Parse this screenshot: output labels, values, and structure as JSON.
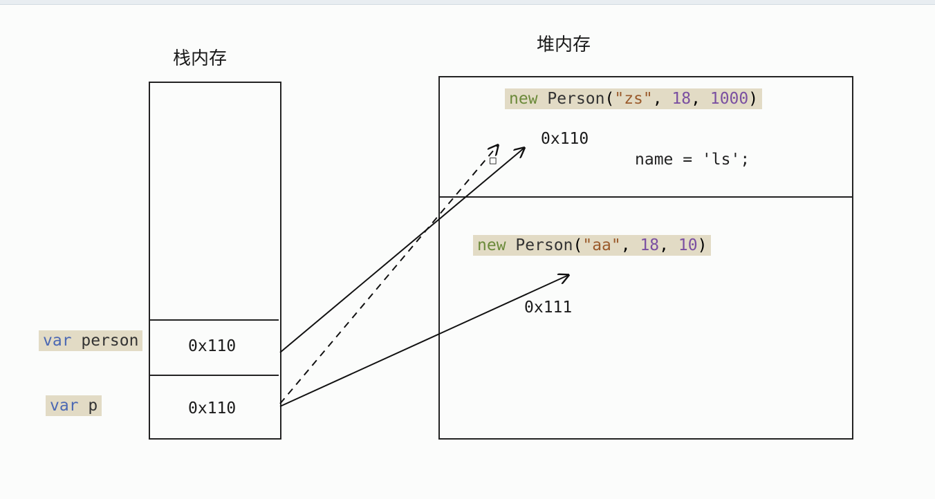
{
  "titles": {
    "stack": "栈内存",
    "heap": "堆内存"
  },
  "stack": {
    "varPerson": "var person",
    "varP": "var p",
    "slot1": "0x110",
    "slot2": "0x110"
  },
  "heap": {
    "obj1": {
      "code": {
        "kwNew": "new",
        "sp1": " ",
        "cls": "Person",
        "open": "(",
        "arg1": "\"zs\"",
        "c1": ", ",
        "arg2": "18",
        "c2": ", ",
        "arg3": "1000",
        "close": ")"
      },
      "addr": "0x110",
      "mutation": "name = 'ls';"
    },
    "obj2": {
      "code": {
        "kwNew": "new",
        "sp1": " ",
        "cls": "Person",
        "open": "(",
        "arg1": "\"aa\"",
        "c1": ", ",
        "arg2": "18",
        "c2": ", ",
        "arg3": "10",
        "close": ")"
      },
      "addr": "0x111"
    }
  },
  "squareGlyph": "□"
}
